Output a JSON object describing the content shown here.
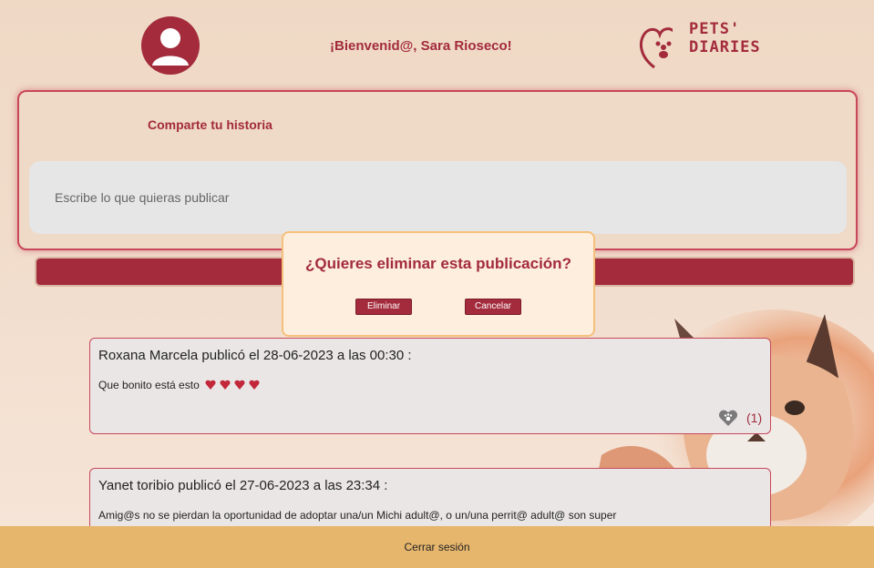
{
  "header": {
    "welcome": "¡Bienvenid@, Sara Rioseco!",
    "logo_line1": "PETS'",
    "logo_line2": "DIARIES"
  },
  "share": {
    "title": "Comparte tu historia",
    "placeholder": "Escribe lo que quieras publicar"
  },
  "modal": {
    "title": "¿Quieres eliminar esta publicación?",
    "confirm_label": "Eliminar",
    "cancel_label": "Cancelar"
  },
  "posts": [
    {
      "header": "Roxana Marcela publicó el 28-06-2023 a las 00:30 :",
      "body": "Que bonito está esto",
      "like_count": "(1)"
    },
    {
      "header": "Yanet toribio publicó el 27-06-2023 a las 23:34 :",
      "body_line1": "Amig@s  no se pierdan la oportunidad de adoptar una/un Michi  adult@, o un/una  perrit@ adult@ son super"
    }
  ],
  "footer": {
    "logout_label": "Cerrar sesión"
  },
  "colors": {
    "brand": "#a32b3c",
    "modal_border": "#f5c07a",
    "footer": "#e6b66d"
  }
}
